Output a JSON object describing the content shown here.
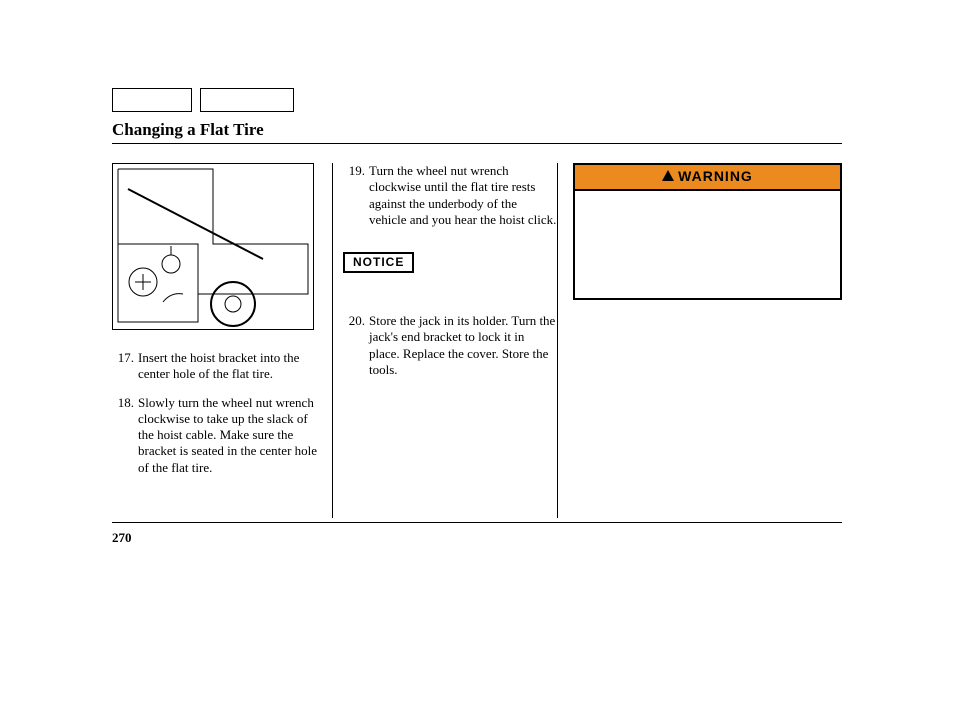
{
  "title": "Changing a Flat Tire",
  "page_number": "270",
  "notice_label": "NOTICE",
  "warning_label": "WARNING",
  "warning_body": "",
  "steps_col1": [
    {
      "n": "17.",
      "t": "Insert the hoist bracket into the center hole of the flat tire."
    },
    {
      "n": "18.",
      "t": "Slowly turn the wheel nut wrench clockwise to take up the slack of the hoist cable. Make sure the bracket is seated in the center hole of the flat tire."
    }
  ],
  "steps_col2a": [
    {
      "n": "19.",
      "t": "Turn the wheel nut wrench clockwise until the flat tire rests against the underbody of the vehicle and you hear the hoist click."
    }
  ],
  "steps_col2b": [
    {
      "n": "20.",
      "t": "Store the jack in its holder. Turn the jack's end bracket to lock it in place. Replace the cover. Store the tools."
    }
  ]
}
